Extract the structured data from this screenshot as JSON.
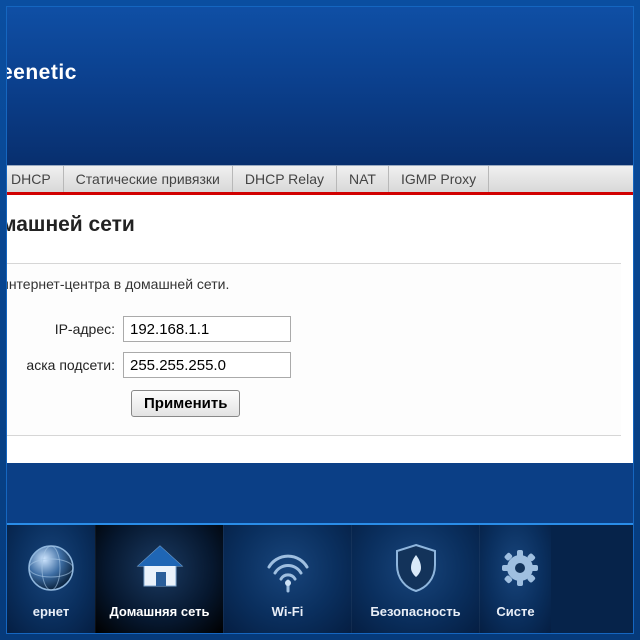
{
  "brand": "eenetic",
  "tabs": {
    "dhcp": "DHCP",
    "static_bindings": "Статические привязки",
    "dhcp_relay": "DHCP Relay",
    "nat": "NAT",
    "igmp_proxy": "IGMP Proxy"
  },
  "page": {
    "title": "машней сети",
    "helptext": "интернет-центра в домашней сети."
  },
  "form": {
    "ip_label": "IP-адрес:",
    "ip_value": "192.168.1.1",
    "mask_label": "аска подсети:",
    "mask_value": "255.255.255.0",
    "submit": "Применить"
  },
  "nav": {
    "internet": "ернет",
    "home_network": "Домашняя сеть",
    "wifi": "Wi-Fi",
    "security": "Безопасность",
    "system": "Систе"
  }
}
